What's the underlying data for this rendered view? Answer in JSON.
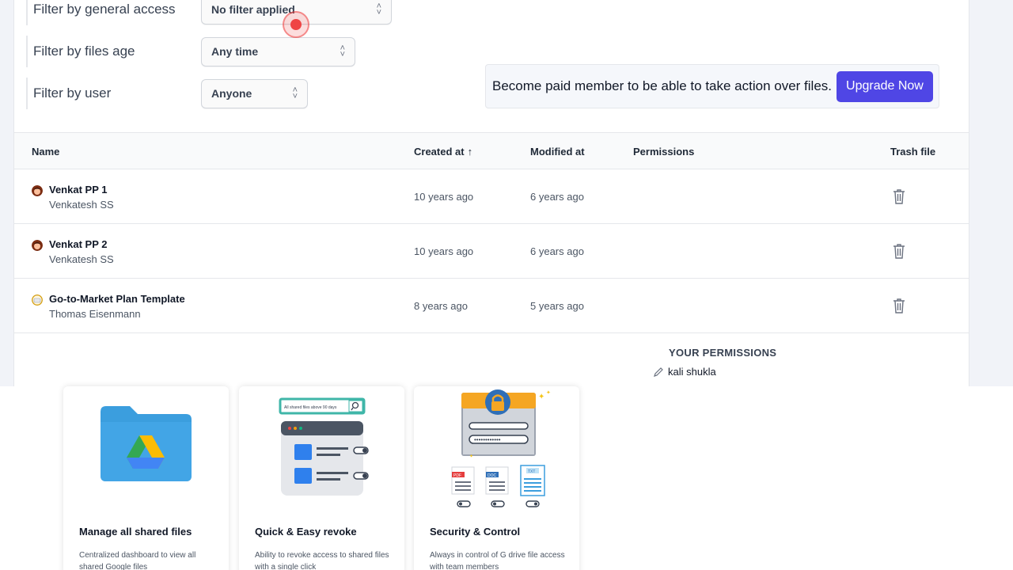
{
  "filters": [
    {
      "label": "Filter by general access",
      "value": "No filter applied"
    },
    {
      "label": "Filter by files age",
      "value": "Any time"
    },
    {
      "label": "Filter by user",
      "value": "Anyone"
    }
  ],
  "upgrade": {
    "message": "Become paid member to be able to take action over files.",
    "button": "Upgrade Now"
  },
  "table": {
    "headers": {
      "name": "Name",
      "created": "Created at",
      "modified": "Modified at",
      "permissions": "Permissions",
      "trash": "Trash file"
    },
    "rows": [
      {
        "name": "Venkat PP 1",
        "owner": "Venkatesh SS",
        "created": "10 years ago",
        "modified": "6 years ago"
      },
      {
        "name": "Venkat PP 2",
        "owner": "Venkatesh SS",
        "created": "10 years ago",
        "modified": "6 years ago"
      },
      {
        "name": "Go-to-Market Plan Template",
        "owner": "Thomas Eisenmann",
        "created": "8 years ago",
        "modified": "5 years ago"
      }
    ]
  },
  "permissions": {
    "title": "YOUR PERMISSIONS",
    "user": "kali shukla"
  },
  "cards": [
    {
      "title": "Manage all shared files",
      "desc": "Centralized dashboard to view all shared Google files"
    },
    {
      "title": "Quick & Easy revoke",
      "desc": "Ability to revoke access to shared files with a single click"
    },
    {
      "title": "Security & Control",
      "desc": "Always in control of G drive file access with team members"
    }
  ],
  "illustrations": {
    "search_text": "All shared files above 90 days",
    "pdf": "PDF",
    "doc": "DOC",
    "txt": "TXT"
  },
  "colors": {
    "accent": "#4f46e5",
    "cursor": "#ef4444"
  }
}
